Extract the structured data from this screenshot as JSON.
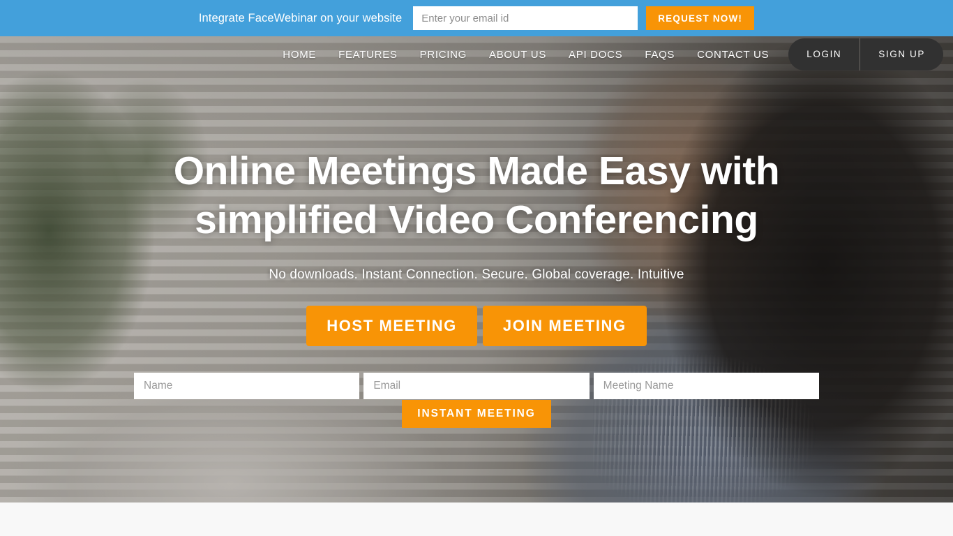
{
  "promo_bar": {
    "text": "Integrate FaceWebinar on your website",
    "email_placeholder": "Enter your email id",
    "email_value": "",
    "button_label": "REQUEST NOW!",
    "background_color": "#43a0db",
    "button_color": "#f89406"
  },
  "nav": {
    "links": [
      {
        "label": "HOME"
      },
      {
        "label": "FEATURES"
      },
      {
        "label": "PRICING"
      },
      {
        "label": "ABOUT US"
      },
      {
        "label": "API DOCS"
      },
      {
        "label": "FAQS"
      },
      {
        "label": "CONTACT US"
      }
    ],
    "auth": {
      "login_label": "LOGIN",
      "signup_label": "SIGN UP",
      "pill_color": "#313131"
    }
  },
  "hero": {
    "headline": "Online Meetings Made Easy with simplified Video Conferencing",
    "subheadline": "No downloads. Instant Connection. Secure. Global coverage. Intuitive",
    "cta": {
      "host_label": "HOST MEETING",
      "join_label": "JOIN MEETING",
      "color": "#f89406"
    },
    "form": {
      "name_placeholder": "Name",
      "name_value": "",
      "email_placeholder": "Email",
      "email_value": "",
      "meeting_placeholder": "Meeting Name",
      "meeting_value": "",
      "submit_label": "INSTANT MEETING"
    }
  },
  "page": {
    "background_color": "#f8f8f8"
  }
}
